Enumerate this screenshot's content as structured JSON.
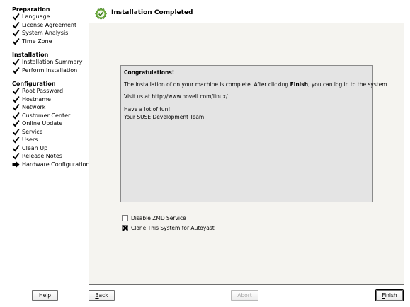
{
  "sidebar": {
    "sections": [
      {
        "title": "Preparation",
        "items": [
          {
            "label": "Language",
            "state": "done"
          },
          {
            "label": "License Agreement",
            "state": "done"
          },
          {
            "label": "System Analysis",
            "state": "done"
          },
          {
            "label": "Time Zone",
            "state": "done"
          }
        ]
      },
      {
        "title": "Installation",
        "items": [
          {
            "label": "Installation Summary",
            "state": "done"
          },
          {
            "label": "Perform Installation",
            "state": "done"
          }
        ]
      },
      {
        "title": "Configuration",
        "items": [
          {
            "label": "Root Password",
            "state": "done"
          },
          {
            "label": "Hostname",
            "state": "done"
          },
          {
            "label": "Network",
            "state": "done"
          },
          {
            "label": "Customer Center",
            "state": "done"
          },
          {
            "label": "Online Update",
            "state": "done"
          },
          {
            "label": "Service",
            "state": "done"
          },
          {
            "label": "Users",
            "state": "done"
          },
          {
            "label": "Clean Up",
            "state": "done"
          },
          {
            "label": "Release Notes",
            "state": "done"
          },
          {
            "label": "Hardware Configuration",
            "state": "current"
          }
        ]
      }
    ]
  },
  "page": {
    "title": "Installation Completed",
    "icon": "check-badge-icon"
  },
  "message": {
    "heading": "Congratulations!",
    "line1_before": "The installation of on your machine is complete. After clicking ",
    "line1_bold": "Finish",
    "line1_after": ", you can log in to the system.",
    "line2": "Visit us at http://www.novell.com/linux/.",
    "line3": "Have a lot of fun!",
    "line4": "Your SUSE Development Team"
  },
  "options": {
    "zmd": {
      "label_u": "D",
      "label_rest": "isable ZMD Service",
      "checked": false
    },
    "clone": {
      "label_u": "C",
      "label_rest": "lone This System for Autoyast",
      "checked": true
    }
  },
  "buttons": {
    "help": "Help",
    "back_u": "B",
    "back_rest": "ack",
    "abort": "Abort",
    "finish_u": "F",
    "finish_rest": "inish"
  },
  "colors": {
    "accent_green": "#5aa02c",
    "panel_bg": "#f5f4f0",
    "message_bg": "#e4e4e4"
  }
}
